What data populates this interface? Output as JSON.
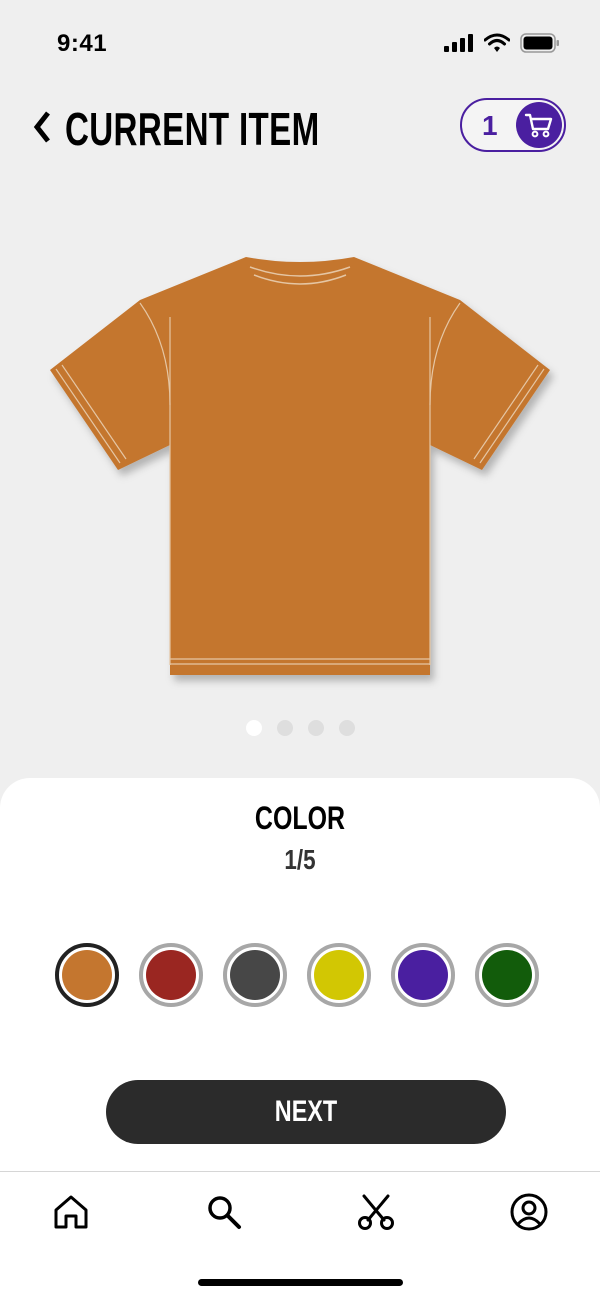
{
  "status_bar": {
    "time": "9:41",
    "icons": [
      "signal-icon",
      "wifi-icon",
      "battery-icon"
    ]
  },
  "header": {
    "back_icon": "chevron-left-icon",
    "title": "CURRENT ITEM",
    "cart_count": "1",
    "cart_icon": "cart-icon"
  },
  "product": {
    "image": "t-shirt",
    "color": "#c4762f",
    "carousel": {
      "count": 4,
      "active_index": 0
    }
  },
  "color_picker": {
    "title": "COLOR",
    "counter": "1/5",
    "selected_index": 0,
    "swatches": [
      {
        "color": "#c4762f"
      },
      {
        "color": "#9a2621"
      },
      {
        "color": "#474747"
      },
      {
        "color": "#d2c703"
      },
      {
        "color": "#4a1fa0"
      },
      {
        "color": "#125c0b"
      }
    ]
  },
  "next_button": {
    "label": "NEXT"
  },
  "tab_bar": {
    "items": [
      {
        "icon": "home-icon"
      },
      {
        "icon": "search-icon"
      },
      {
        "icon": "scissors-icon"
      },
      {
        "icon": "profile-icon"
      }
    ]
  },
  "colors": {
    "accent": "#4a1fa0",
    "button_dark": "#2b2b2b",
    "background": "#efefef"
  }
}
